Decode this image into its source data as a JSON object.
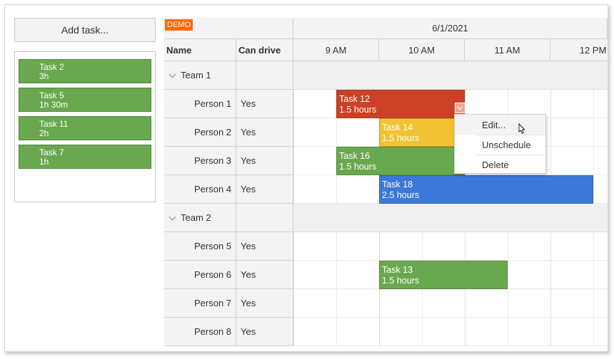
{
  "queue": {
    "add_label": "Add task...",
    "items": [
      {
        "name": "Task 2",
        "duration": "3h"
      },
      {
        "name": "Task 5",
        "duration": "1h 30m"
      },
      {
        "name": "Task 11",
        "duration": "2h"
      },
      {
        "name": "Task 7",
        "duration": "1h"
      }
    ]
  },
  "scheduler": {
    "demo_badge": "DEMO",
    "date": "6/1/2021",
    "columns": {
      "name": "Name",
      "can_drive": "Can drive"
    },
    "hours": [
      "9 AM",
      "10 AM",
      "11 AM",
      "12 PM"
    ],
    "rows": [
      {
        "kind": "group",
        "name": "Team 1",
        "can_drive": ""
      },
      {
        "kind": "person",
        "name": "Person 1",
        "can_drive": "Yes"
      },
      {
        "kind": "person",
        "name": "Person 2",
        "can_drive": "Yes"
      },
      {
        "kind": "person",
        "name": "Person 3",
        "can_drive": "Yes"
      },
      {
        "kind": "person",
        "name": "Person 4",
        "can_drive": "Yes"
      },
      {
        "kind": "group",
        "name": "Team 2",
        "can_drive": ""
      },
      {
        "kind": "person",
        "name": "Person 5",
        "can_drive": "Yes"
      },
      {
        "kind": "person",
        "name": "Person 6",
        "can_drive": "Yes"
      },
      {
        "kind": "person",
        "name": "Person 7",
        "can_drive": "Yes"
      },
      {
        "kind": "person",
        "name": "Person 8",
        "can_drive": "Yes"
      }
    ],
    "events": [
      {
        "row": 1,
        "name": "Task 12",
        "duration": "1.5 hours",
        "start_hour": 9.0,
        "end_hour": 10.5,
        "color": "#cc4125"
      },
      {
        "row": 2,
        "name": "Task 14",
        "duration": "1.5 hours",
        "start_hour": 9.5,
        "end_hour": 11.0,
        "color": "#f1c232"
      },
      {
        "row": 3,
        "name": "Task 16",
        "duration": "1.5 hours",
        "start_hour": 9.0,
        "end_hour": 10.5,
        "color": "#6aa84f"
      },
      {
        "row": 4,
        "name": "Task 18",
        "duration": "2.5 hours",
        "start_hour": 9.5,
        "end_hour": 12.0,
        "color": "#3c78d8"
      },
      {
        "row": 7,
        "name": "Task 13",
        "duration": "1.5 hours",
        "start_hour": 9.5,
        "end_hour": 11.0,
        "color": "#6aa84f"
      }
    ]
  },
  "context_menu": {
    "items": [
      "Edit...",
      "Unschedule",
      "Delete"
    ]
  }
}
